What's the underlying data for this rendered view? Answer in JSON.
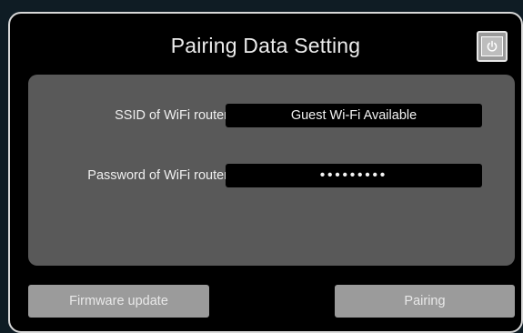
{
  "dialog": {
    "title": "Pairing Data Setting",
    "power_icon": "power-icon"
  },
  "settings": {
    "ssid": {
      "label": "SSID of WiFi router",
      "value": "Guest Wi-Fi Available"
    },
    "password": {
      "label": "Password of WiFi router",
      "value": "•••••••••"
    }
  },
  "buttons": {
    "firmware_update": "Firmware update",
    "pairing": "Pairing"
  },
  "colors": {
    "background": "#0f1c24",
    "panel": "#000000",
    "settings_box": "#595959",
    "button": "#9b9b9b",
    "text": "#f0f0f0"
  }
}
